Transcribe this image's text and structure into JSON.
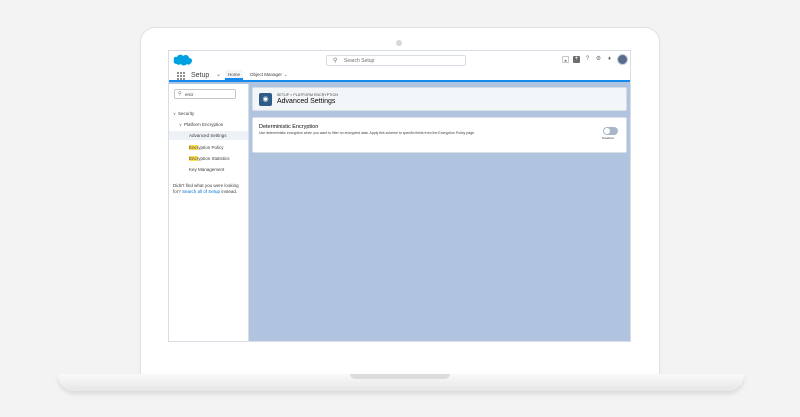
{
  "search": {
    "placeholder": "Search Setup"
  },
  "app": {
    "name": "Setup"
  },
  "tabs": [
    {
      "label": "Home"
    },
    {
      "label": "Object Manager"
    }
  ],
  "sidebar": {
    "quick_find_value": "encr",
    "items": [
      {
        "label": "Security"
      },
      {
        "label": "Platform Encryption"
      },
      {
        "label": "Advanced Settings"
      },
      {
        "label_hl": "Encr",
        "label_rest": "yption Policy"
      },
      {
        "label_hl": "Encr",
        "label_rest": "yption Statistics"
      },
      {
        "label": "Key Management"
      }
    ],
    "help_text": "Didn't find what you were looking for?",
    "help_link": "Search all of Setup",
    "help_suffix": "instead."
  },
  "header": {
    "breadcrumb": "SETUP > PLATFORM ENCRYPTION",
    "title": "Advanced Settings"
  },
  "encryption_card": {
    "title": "Deterministic Encryption",
    "description": "Use deterministic encryption when you want to filter on encrypted data. Apply this scheme to specific fields from the Encryption Policy page.",
    "toggle_label": "Disabled",
    "toggle_on": false
  },
  "colors": {
    "brand": "#1589ee",
    "screen_bg": "#b0c4df",
    "link": "#0070d2",
    "highlight": "#ffde54"
  }
}
